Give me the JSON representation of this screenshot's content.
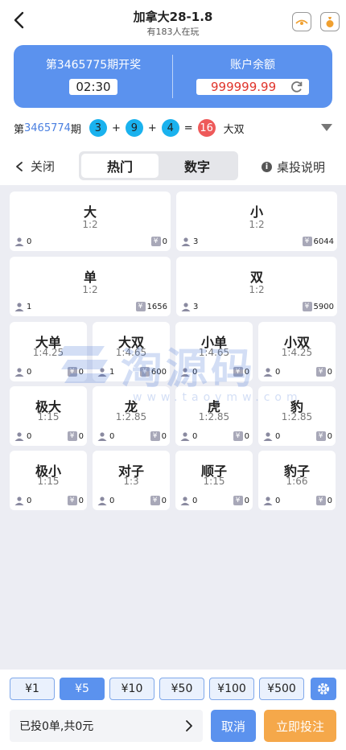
{
  "header": {
    "title": "加拿大28-1.8",
    "subtitle": "有183人在玩"
  },
  "draw": {
    "period_label": "第3465775期开奖",
    "countdown": "02:30",
    "balance_label": "账户余额",
    "balance": "999999.99"
  },
  "last_draw": {
    "prefix": "第",
    "issue": "3465774",
    "suffix": "期",
    "balls": [
      "3",
      "9",
      "4"
    ],
    "plus": "+",
    "equals": "=",
    "sum": "16",
    "result": "大双"
  },
  "tabs": {
    "close_label": "关闭",
    "hot_label": "热门",
    "number_label": "数字",
    "help_label": "桌投说明",
    "info_glyph": "i"
  },
  "big_cards": [
    {
      "name": "大",
      "odds": "1:2",
      "users": "0",
      "amount": "0"
    },
    {
      "name": "小",
      "odds": "1:2",
      "users": "3",
      "amount": "6044"
    },
    {
      "name": "单",
      "odds": "1:2",
      "users": "1",
      "amount": "1656"
    },
    {
      "name": "双",
      "odds": "1:2",
      "users": "3",
      "amount": "5900"
    }
  ],
  "small_cards": [
    {
      "name": "大单",
      "odds": "1:4.25",
      "users": "0",
      "amount": "0"
    },
    {
      "name": "大双",
      "odds": "1:4.65",
      "users": "1",
      "amount": "600"
    },
    {
      "name": "小单",
      "odds": "1:4.65",
      "users": "0",
      "amount": "0"
    },
    {
      "name": "小双",
      "odds": "1:4.25",
      "users": "0",
      "amount": "0"
    },
    {
      "name": "极大",
      "odds": "1:15",
      "users": "0",
      "amount": "0"
    },
    {
      "name": "龙",
      "odds": "1:2.85",
      "users": "0",
      "amount": "0"
    },
    {
      "name": "虎",
      "odds": "1:2.85",
      "users": "0",
      "amount": "0"
    },
    {
      "name": "豹",
      "odds": "1:2.85",
      "users": "0",
      "amount": "0"
    },
    {
      "name": "极小",
      "odds": "1:15",
      "users": "0",
      "amount": "0"
    },
    {
      "name": "对子",
      "odds": "1:3",
      "users": "0",
      "amount": "0"
    },
    {
      "name": "顺子",
      "odds": "1:15",
      "users": "0",
      "amount": "0"
    },
    {
      "name": "豹子",
      "odds": "1:66",
      "users": "0",
      "amount": "0"
    }
  ],
  "yen_glyph": "¥",
  "watermark": {
    "text": "淘源码",
    "sub": "www.taoymw.com"
  },
  "chips": [
    "¥1",
    "¥5",
    "¥10",
    "¥50",
    "¥100",
    "¥500"
  ],
  "selected_chip": "¥5",
  "footer": {
    "summary": "已投0单,共0元",
    "cancel_label": "取消",
    "bet_label": "立即投注"
  },
  "colors": {
    "primary": "#5b92ee",
    "accent_orange": "#f5a84a",
    "ball_blue": "#1ab2ee",
    "ball_red": "#ee5a5a",
    "balance_red": "#e0342b"
  }
}
